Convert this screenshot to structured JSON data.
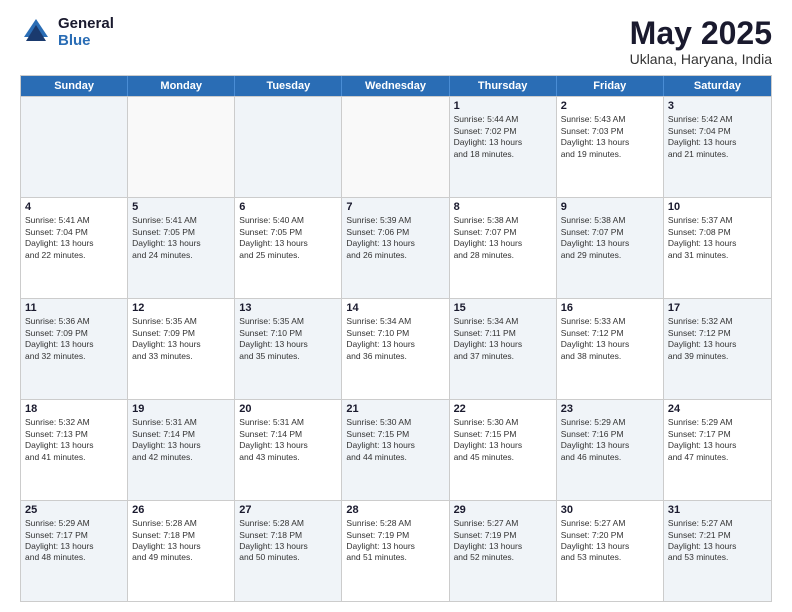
{
  "logo": {
    "general": "General",
    "blue": "Blue"
  },
  "title": {
    "month": "May 2025",
    "location": "Uklana, Haryana, India"
  },
  "days": [
    "Sunday",
    "Monday",
    "Tuesday",
    "Wednesday",
    "Thursday",
    "Friday",
    "Saturday"
  ],
  "rows": [
    [
      {
        "day": "",
        "text": "",
        "shaded": true
      },
      {
        "day": "",
        "text": "",
        "shaded": false
      },
      {
        "day": "",
        "text": "",
        "shaded": true
      },
      {
        "day": "",
        "text": "",
        "shaded": false
      },
      {
        "day": "1",
        "text": "Sunrise: 5:44 AM\nSunset: 7:02 PM\nDaylight: 13 hours\nand 18 minutes.",
        "shaded": true
      },
      {
        "day": "2",
        "text": "Sunrise: 5:43 AM\nSunset: 7:03 PM\nDaylight: 13 hours\nand 19 minutes.",
        "shaded": false
      },
      {
        "day": "3",
        "text": "Sunrise: 5:42 AM\nSunset: 7:04 PM\nDaylight: 13 hours\nand 21 minutes.",
        "shaded": true
      }
    ],
    [
      {
        "day": "4",
        "text": "Sunrise: 5:41 AM\nSunset: 7:04 PM\nDaylight: 13 hours\nand 22 minutes.",
        "shaded": false
      },
      {
        "day": "5",
        "text": "Sunrise: 5:41 AM\nSunset: 7:05 PM\nDaylight: 13 hours\nand 24 minutes.",
        "shaded": true
      },
      {
        "day": "6",
        "text": "Sunrise: 5:40 AM\nSunset: 7:05 PM\nDaylight: 13 hours\nand 25 minutes.",
        "shaded": false
      },
      {
        "day": "7",
        "text": "Sunrise: 5:39 AM\nSunset: 7:06 PM\nDaylight: 13 hours\nand 26 minutes.",
        "shaded": true
      },
      {
        "day": "8",
        "text": "Sunrise: 5:38 AM\nSunset: 7:07 PM\nDaylight: 13 hours\nand 28 minutes.",
        "shaded": false
      },
      {
        "day": "9",
        "text": "Sunrise: 5:38 AM\nSunset: 7:07 PM\nDaylight: 13 hours\nand 29 minutes.",
        "shaded": true
      },
      {
        "day": "10",
        "text": "Sunrise: 5:37 AM\nSunset: 7:08 PM\nDaylight: 13 hours\nand 31 minutes.",
        "shaded": false
      }
    ],
    [
      {
        "day": "11",
        "text": "Sunrise: 5:36 AM\nSunset: 7:09 PM\nDaylight: 13 hours\nand 32 minutes.",
        "shaded": true
      },
      {
        "day": "12",
        "text": "Sunrise: 5:35 AM\nSunset: 7:09 PM\nDaylight: 13 hours\nand 33 minutes.",
        "shaded": false
      },
      {
        "day": "13",
        "text": "Sunrise: 5:35 AM\nSunset: 7:10 PM\nDaylight: 13 hours\nand 35 minutes.",
        "shaded": true
      },
      {
        "day": "14",
        "text": "Sunrise: 5:34 AM\nSunset: 7:10 PM\nDaylight: 13 hours\nand 36 minutes.",
        "shaded": false
      },
      {
        "day": "15",
        "text": "Sunrise: 5:34 AM\nSunset: 7:11 PM\nDaylight: 13 hours\nand 37 minutes.",
        "shaded": true
      },
      {
        "day": "16",
        "text": "Sunrise: 5:33 AM\nSunset: 7:12 PM\nDaylight: 13 hours\nand 38 minutes.",
        "shaded": false
      },
      {
        "day": "17",
        "text": "Sunrise: 5:32 AM\nSunset: 7:12 PM\nDaylight: 13 hours\nand 39 minutes.",
        "shaded": true
      }
    ],
    [
      {
        "day": "18",
        "text": "Sunrise: 5:32 AM\nSunset: 7:13 PM\nDaylight: 13 hours\nand 41 minutes.",
        "shaded": false
      },
      {
        "day": "19",
        "text": "Sunrise: 5:31 AM\nSunset: 7:14 PM\nDaylight: 13 hours\nand 42 minutes.",
        "shaded": true
      },
      {
        "day": "20",
        "text": "Sunrise: 5:31 AM\nSunset: 7:14 PM\nDaylight: 13 hours\nand 43 minutes.",
        "shaded": false
      },
      {
        "day": "21",
        "text": "Sunrise: 5:30 AM\nSunset: 7:15 PM\nDaylight: 13 hours\nand 44 minutes.",
        "shaded": true
      },
      {
        "day": "22",
        "text": "Sunrise: 5:30 AM\nSunset: 7:15 PM\nDaylight: 13 hours\nand 45 minutes.",
        "shaded": false
      },
      {
        "day": "23",
        "text": "Sunrise: 5:29 AM\nSunset: 7:16 PM\nDaylight: 13 hours\nand 46 minutes.",
        "shaded": true
      },
      {
        "day": "24",
        "text": "Sunrise: 5:29 AM\nSunset: 7:17 PM\nDaylight: 13 hours\nand 47 minutes.",
        "shaded": false
      }
    ],
    [
      {
        "day": "25",
        "text": "Sunrise: 5:29 AM\nSunset: 7:17 PM\nDaylight: 13 hours\nand 48 minutes.",
        "shaded": true
      },
      {
        "day": "26",
        "text": "Sunrise: 5:28 AM\nSunset: 7:18 PM\nDaylight: 13 hours\nand 49 minutes.",
        "shaded": false
      },
      {
        "day": "27",
        "text": "Sunrise: 5:28 AM\nSunset: 7:18 PM\nDaylight: 13 hours\nand 50 minutes.",
        "shaded": true
      },
      {
        "day": "28",
        "text": "Sunrise: 5:28 AM\nSunset: 7:19 PM\nDaylight: 13 hours\nand 51 minutes.",
        "shaded": false
      },
      {
        "day": "29",
        "text": "Sunrise: 5:27 AM\nSunset: 7:19 PM\nDaylight: 13 hours\nand 52 minutes.",
        "shaded": true
      },
      {
        "day": "30",
        "text": "Sunrise: 5:27 AM\nSunset: 7:20 PM\nDaylight: 13 hours\nand 53 minutes.",
        "shaded": false
      },
      {
        "day": "31",
        "text": "Sunrise: 5:27 AM\nSunset: 7:21 PM\nDaylight: 13 hours\nand 53 minutes.",
        "shaded": true
      }
    ]
  ]
}
